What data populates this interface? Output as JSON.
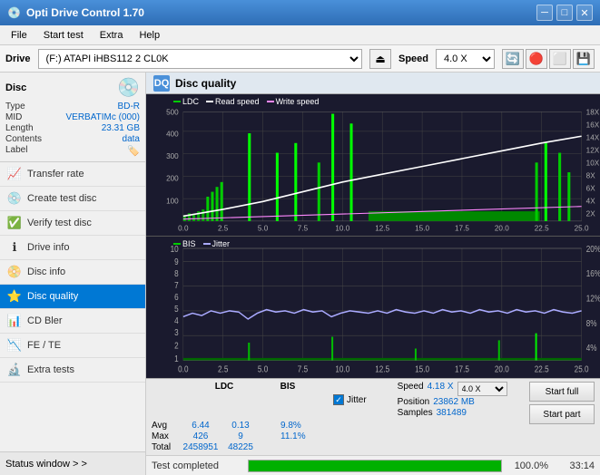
{
  "app": {
    "title": "Opti Drive Control 1.70",
    "icon": "💿"
  },
  "titlebar": {
    "minimize_label": "─",
    "maximize_label": "□",
    "close_label": "✕"
  },
  "menubar": {
    "items": [
      "File",
      "Start test",
      "Extra",
      "Help"
    ]
  },
  "drivebar": {
    "label": "Drive",
    "drive_value": "(F:)  ATAPI iHBS112  2 CL0K",
    "speed_label": "Speed",
    "speed_value": "4.0 X",
    "eject_icon": "⏏"
  },
  "disc": {
    "label": "Disc",
    "type_label": "Type",
    "type_value": "BD-R",
    "mid_label": "MID",
    "mid_value": "VERBATIMc (000)",
    "length_label": "Length",
    "length_value": "23.31 GB",
    "contents_label": "Contents",
    "contents_value": "data",
    "label_label": "Label",
    "label_value": ""
  },
  "nav": {
    "items": [
      {
        "id": "transfer-rate",
        "label": "Transfer rate",
        "icon": "📈"
      },
      {
        "id": "create-test-disc",
        "label": "Create test disc",
        "icon": "💿"
      },
      {
        "id": "verify-test-disc",
        "label": "Verify test disc",
        "icon": "✅"
      },
      {
        "id": "drive-info",
        "label": "Drive info",
        "icon": "ℹ"
      },
      {
        "id": "disc-info",
        "label": "Disc info",
        "icon": "📀"
      },
      {
        "id": "disc-quality",
        "label": "Disc quality",
        "icon": "⭐",
        "active": true
      },
      {
        "id": "cd-bler",
        "label": "CD Bler",
        "icon": "📊"
      },
      {
        "id": "fe-te",
        "label": "FE / TE",
        "icon": "📉"
      },
      {
        "id": "extra-tests",
        "label": "Extra tests",
        "icon": "🔬"
      }
    ]
  },
  "status_window": {
    "label": "Status window > >"
  },
  "disc_quality": {
    "title": "Disc quality",
    "legend": {
      "ldc": "LDC",
      "read_speed": "Read speed",
      "write_speed": "Write speed",
      "bis": "BIS",
      "jitter": "Jitter"
    },
    "chart1": {
      "y_max": 500,
      "y_right_max": 18,
      "x_max": 25,
      "x_labels": [
        "0.0",
        "2.5",
        "5.0",
        "7.5",
        "10.0",
        "12.5",
        "15.0",
        "17.5",
        "20.0",
        "22.5",
        "25.0"
      ],
      "y_left_labels": [
        "500",
        "400",
        "300",
        "200",
        "100"
      ],
      "y_right_labels": [
        "18X",
        "16X",
        "14X",
        "12X",
        "10X",
        "8X",
        "6X",
        "4X",
        "2X"
      ]
    },
    "chart2": {
      "y_max": 10,
      "y_right_max": 20,
      "x_max": 25,
      "x_labels": [
        "0.0",
        "2.5",
        "5.0",
        "7.5",
        "10.0",
        "12.5",
        "15.0",
        "17.5",
        "20.0",
        "22.5",
        "25.0"
      ],
      "y_left_labels": [
        "10",
        "9",
        "8",
        "7",
        "6",
        "5",
        "4",
        "3",
        "2",
        "1"
      ],
      "y_right_labels": [
        "20%",
        "16%",
        "12%",
        "8%",
        "4%"
      ]
    }
  },
  "stats": {
    "headers": [
      "LDC",
      "BIS"
    ],
    "jitter_label": "Jitter",
    "jitter_checked": true,
    "avg_label": "Avg",
    "max_label": "Max",
    "total_label": "Total",
    "ldc_avg": "6.44",
    "ldc_max": "426",
    "ldc_total": "2458951",
    "bis_avg": "0.13",
    "bis_max": "9",
    "bis_total": "48225",
    "jitter_avg": "9.8%",
    "jitter_max": "11.1%",
    "jitter_total": "",
    "speed_label": "Speed",
    "speed_value": "4.18 X",
    "speed_select": "4.0 X",
    "position_label": "Position",
    "position_value": "23862 MB",
    "samples_label": "Samples",
    "samples_value": "381489"
  },
  "buttons": {
    "start_full": "Start full",
    "start_part": "Start part"
  },
  "progress": {
    "status_text": "Test completed",
    "percent": "100.0%",
    "time": "33:14"
  }
}
